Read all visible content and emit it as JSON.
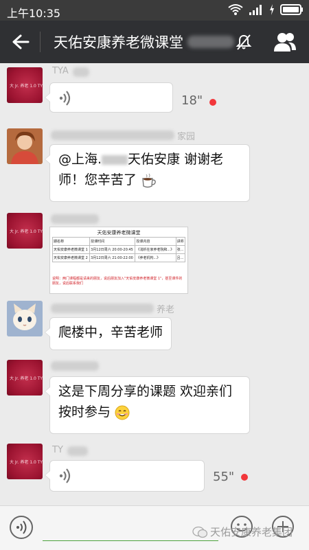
{
  "status_bar": {
    "time": "上午10:35"
  },
  "header": {
    "title": "天佑安康养老微课堂"
  },
  "messages": {
    "m1": {
      "sender": "TYA",
      "duration": "18\""
    },
    "m2": {
      "sender": "家园",
      "text_line1": "@上海.",
      "text_name": "天佑安康 谢谢老",
      "text_line2": "师！您辛苦了"
    },
    "m3": {
      "title": "天佑安康养老微课堂",
      "headers": [
        "期名称",
        "授课时间",
        "授课内容",
        "讲师"
      ],
      "rows": [
        [
          "天佑安康养老微课堂 1",
          "3月12日周六 20:00-20:45",
          "《浅析在家养老院和...》",
          "张..."
        ],
        [
          "天佑安康养老微课堂 2",
          "3月12日周六 21:00-22:00",
          "《养老机构...》",
          "吕..."
        ]
      ],
      "notice": "说明：两门课程都是请来的朋友，说后朋友加入\"天佑安康养老微课堂 1\"，甚至课件的朋友，说后联系我们"
    },
    "m4": {
      "sender": "养老",
      "text": "爬楼中，辛苦老师"
    },
    "m5": {
      "text_line1": "这是下周分享的课题 欢迎亲们",
      "text_line2": "按时参与"
    },
    "m6": {
      "sender": "TY",
      "duration": "55\""
    }
  },
  "watermark": "天佑安康养老集团",
  "colors": {
    "header_bg": "#2f3033",
    "status_bg": "#3b3b3b",
    "chat_bg": "#ebebeb",
    "unread_dot": "#f2373b",
    "input_line": "#4aa23a"
  },
  "icons": [
    "back-arrow-icon",
    "mute-icon",
    "group-members-icon",
    "voice-wave-icon",
    "smile-emoji-icon",
    "plus-icon",
    "wifi-icon",
    "signal-icon",
    "battery-icon"
  ]
}
